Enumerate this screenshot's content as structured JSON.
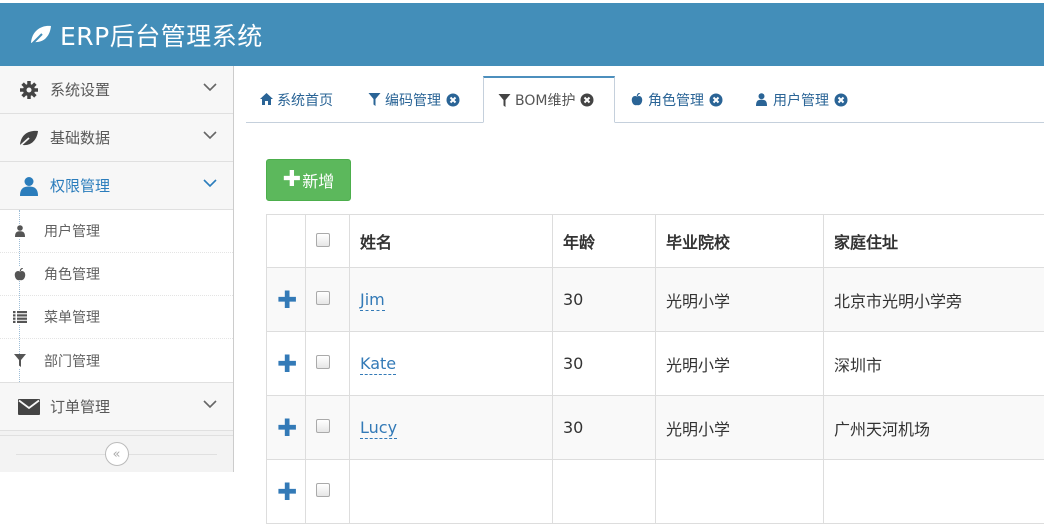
{
  "header": {
    "title": "ERP后台管理系统",
    "logo_icon": "leaf-icon"
  },
  "sidebar": {
    "menus": [
      {
        "label": "系统设置",
        "icon": "gear-icon"
      },
      {
        "label": "基础数据",
        "icon": "leaf-icon"
      },
      {
        "label": "权限管理",
        "icon": "user-icon"
      },
      {
        "label": "订单管理",
        "icon": "envelope-icon"
      }
    ],
    "submenu": [
      {
        "label": "用户管理",
        "icon": "user-icon"
      },
      {
        "label": "角色管理",
        "icon": "apple-icon"
      },
      {
        "label": "菜单管理",
        "icon": "list-icon"
      },
      {
        "label": "部门管理",
        "icon": "filter-icon"
      }
    ],
    "collapse_glyph": "«"
  },
  "tabs": [
    {
      "label": "系统首页",
      "icon": "home-icon"
    },
    {
      "label": "编码管理",
      "icon": "filter-icon"
    },
    {
      "label": "BOM维护",
      "icon": "filter-icon"
    },
    {
      "label": "角色管理",
      "icon": "apple-icon"
    },
    {
      "label": "用户管理",
      "icon": "user-icon"
    }
  ],
  "toolbar": {
    "add_label": "新增",
    "add_glyph": "✚"
  },
  "table": {
    "columns": [
      "姓名",
      "年龄",
      "毕业院校",
      "家庭住址"
    ],
    "expand_glyph": "✚",
    "rows": [
      {
        "name": "Jim",
        "age": "30",
        "school": "光明小学",
        "address": "北京市光明小学旁"
      },
      {
        "name": "Kate",
        "age": "30",
        "school": "光明小学",
        "address": "深圳市"
      },
      {
        "name": "Lucy",
        "age": "30",
        "school": "光明小学",
        "address": "广州天河机场"
      },
      {
        "name": "",
        "age": "",
        "school": "",
        "address": ""
      }
    ]
  },
  "colors": {
    "header_bg": "#438eb9",
    "add_button": "#5cb85c",
    "link": "#337ab7",
    "active_menu": "#2b7dbc"
  }
}
